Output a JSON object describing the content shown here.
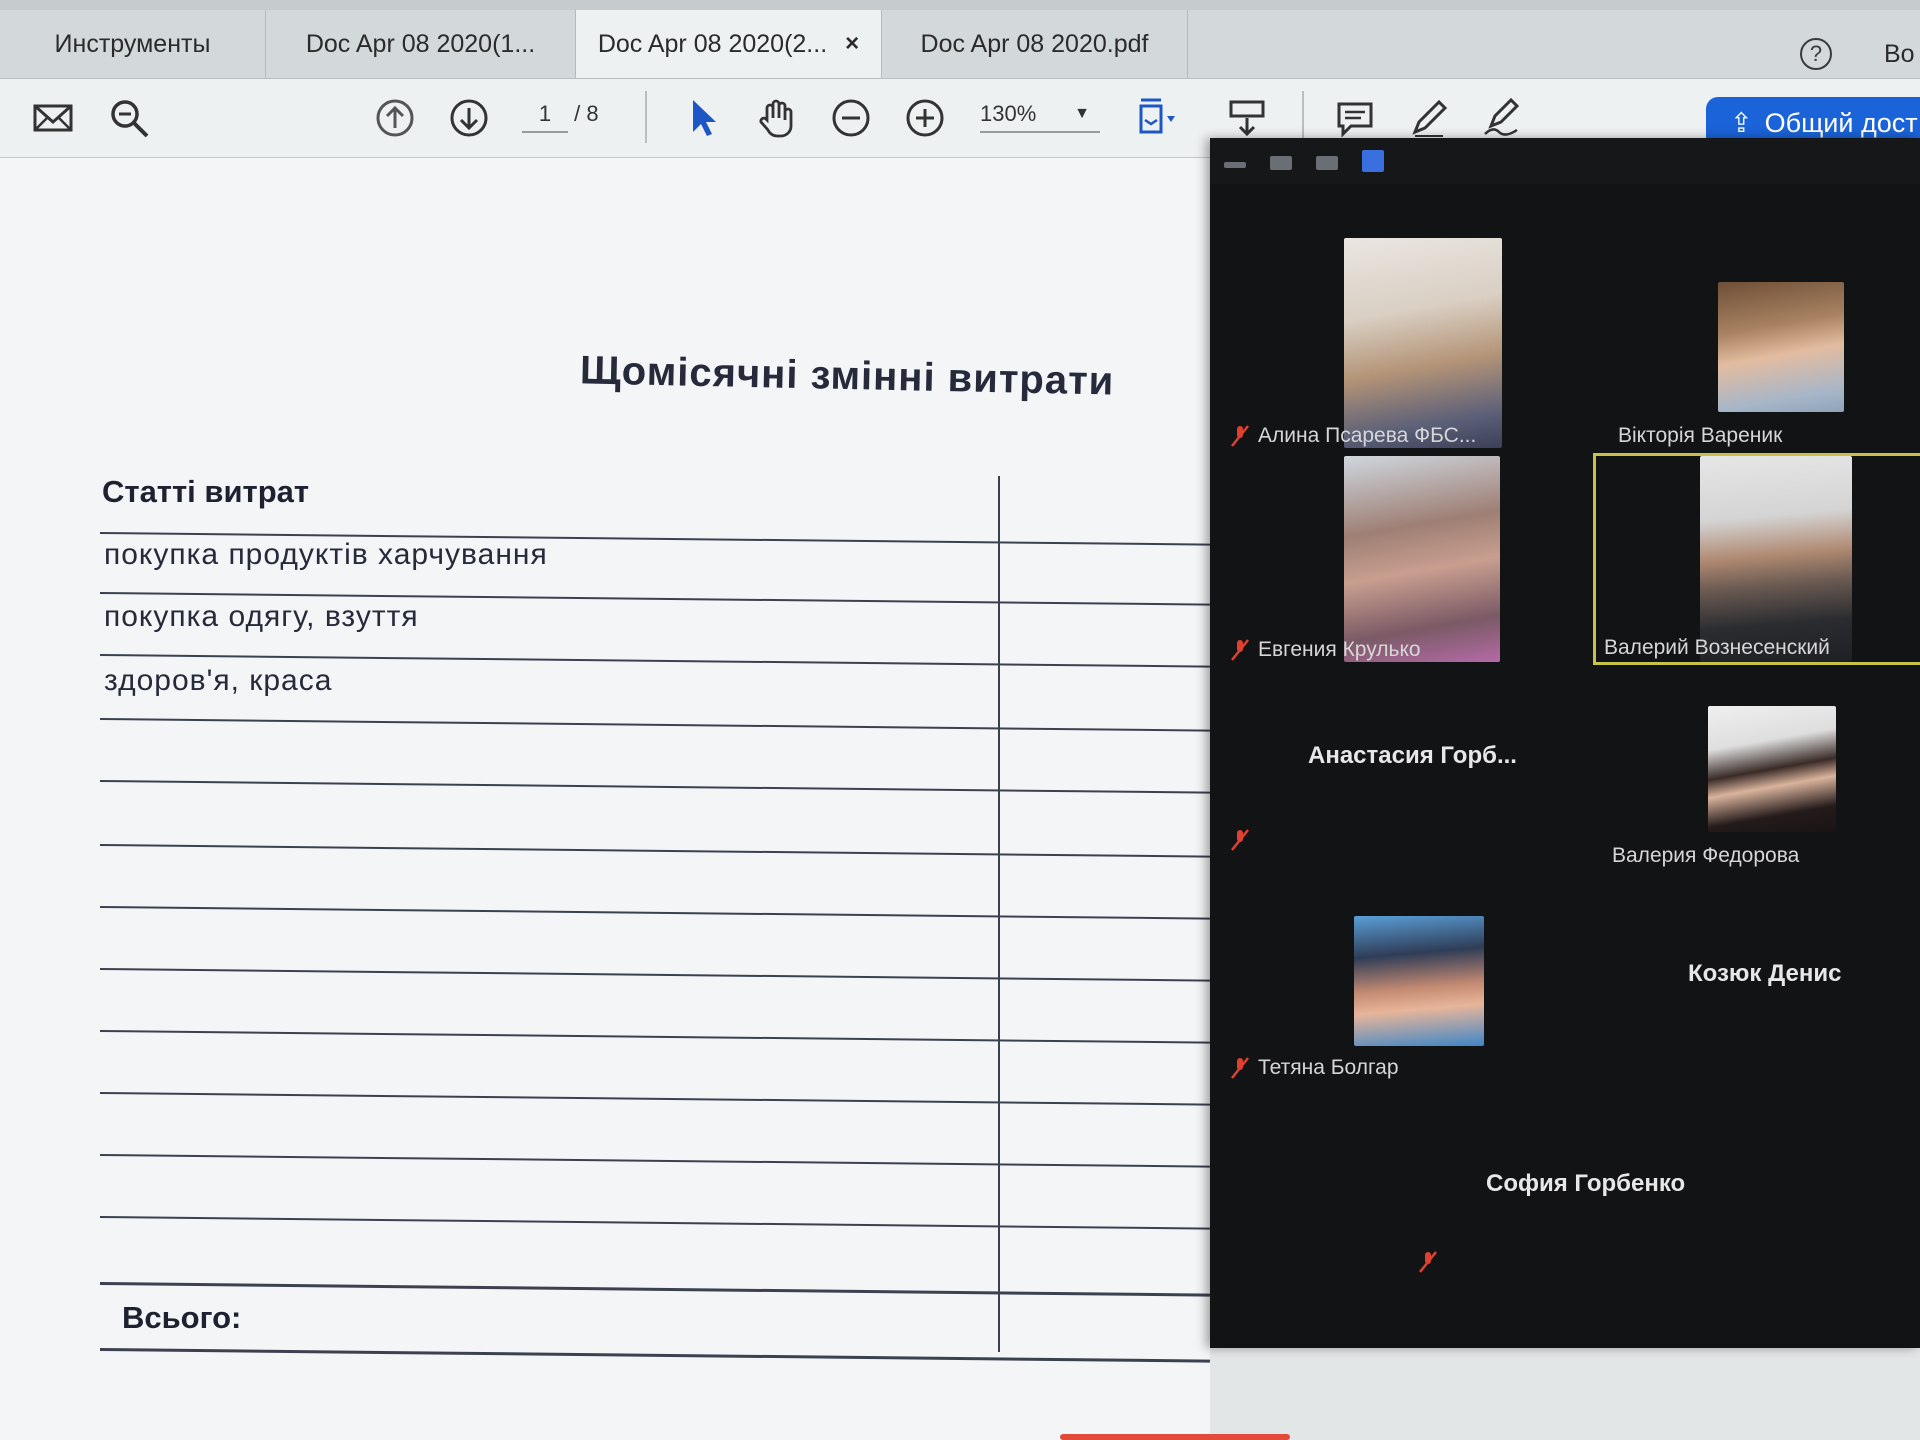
{
  "tabs": [
    {
      "label": "Инструменты"
    },
    {
      "label": "Doc Apr 08 2020(1..."
    },
    {
      "label": "Doc Apr 08 2020(2...",
      "close": "×"
    },
    {
      "label": "Doc Apr 08 2020.pdf"
    }
  ],
  "header": {
    "help": "?",
    "signin": "Во"
  },
  "toolbar": {
    "page_current": "1",
    "page_total": "/ 8",
    "zoom": "130%",
    "share_label": "Общий дост"
  },
  "document": {
    "title": "Щомісячні змінні витрати",
    "column_header": "Статті витрат",
    "rows": [
      "покупка  продуктів харчування",
      "покупка одягу, взуття",
      "здоров'я,  краса"
    ],
    "total_label": "Всього:"
  },
  "participants": [
    {
      "name": "Алина Псарева ФБС...",
      "muted": true
    },
    {
      "name": "Вікторія Вареник",
      "muted": false
    },
    {
      "name": "Евгения Крулько",
      "muted": true
    },
    {
      "name": "Валерий Вознесенский",
      "muted": false,
      "active": true
    },
    {
      "name": "Анастасия  Горб...",
      "muted": true
    },
    {
      "name": "Валерия Федорова",
      "muted": false
    },
    {
      "name": "Тетяна Болгар",
      "muted": true
    },
    {
      "name": "Козюк Денис",
      "muted": false
    },
    {
      "name": "София Горбенко",
      "muted": true
    }
  ],
  "colors": {
    "accent": "#1b63d8",
    "mute": "#e0402f",
    "active_speaker": "#c9c24a",
    "panel": "#121315"
  }
}
